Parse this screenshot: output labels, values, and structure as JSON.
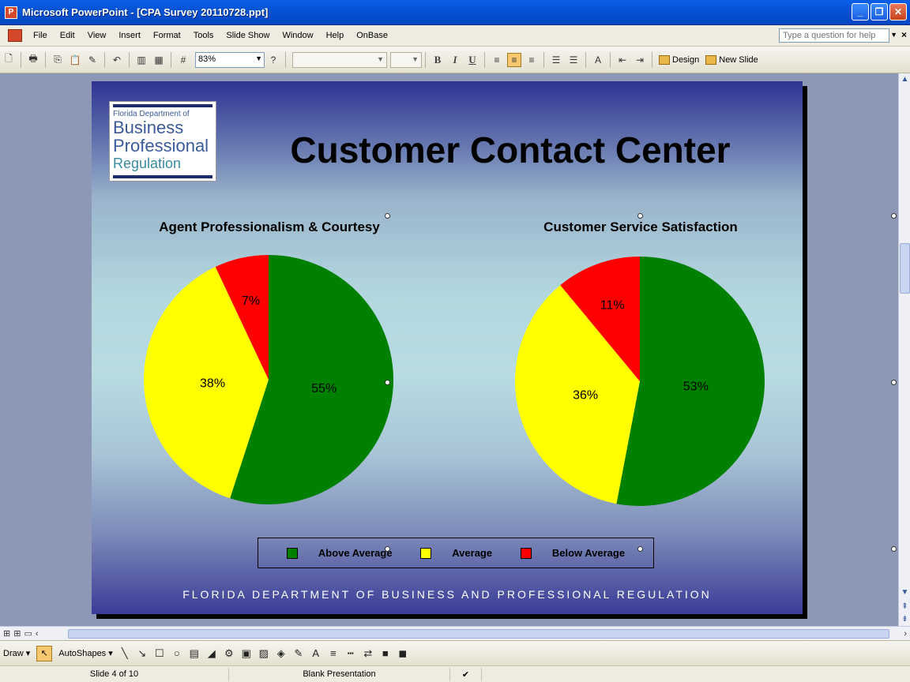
{
  "window": {
    "title": "Microsoft PowerPoint - [CPA Survey 20110728.ppt]",
    "app_icon": "powerpoint-icon"
  },
  "menu": {
    "items": [
      "File",
      "Edit",
      "View",
      "Insert",
      "Format",
      "Tools",
      "Slide Show",
      "Window",
      "Help",
      "OnBase"
    ],
    "help_placeholder": "Type a question for help"
  },
  "toolbar": {
    "zoom": "83%",
    "design_label": "Design",
    "new_slide_label": "New Slide"
  },
  "slide": {
    "logo": {
      "line1": "Florida Department of",
      "line2": "Business",
      "line3": "Professional",
      "line4": "Regulation"
    },
    "title": "Customer Contact Center",
    "footer": "FLORIDA DEPARTMENT OF BUSINESS AND PROFESSIONAL REGULATION",
    "legend": [
      {
        "label": "Above Average",
        "color": "#008000"
      },
      {
        "label": "Average",
        "color": "#ffff00"
      },
      {
        "label": "Below Average",
        "color": "#ff0000"
      }
    ]
  },
  "chart_data": [
    {
      "type": "pie",
      "title": "Agent Professionalism & Courtesy",
      "categories": [
        "Above Average",
        "Average",
        "Below Average"
      ],
      "values": [
        55,
        38,
        7
      ],
      "labels": [
        "55%",
        "38%",
        "7%"
      ],
      "colors": [
        "#008000",
        "#ffff00",
        "#ff0000"
      ]
    },
    {
      "type": "pie",
      "title": "Customer Service Satisfaction",
      "categories": [
        "Above Average",
        "Average",
        "Below Average"
      ],
      "values": [
        53,
        36,
        11
      ],
      "labels": [
        "53%",
        "36%",
        "11%"
      ],
      "colors": [
        "#008000",
        "#ffff00",
        "#ff0000"
      ]
    }
  ],
  "drawbar": {
    "draw_label": "Draw",
    "autoshapes_label": "AutoShapes"
  },
  "status": {
    "slide": "Slide 4 of 10",
    "design": "Blank Presentation"
  }
}
